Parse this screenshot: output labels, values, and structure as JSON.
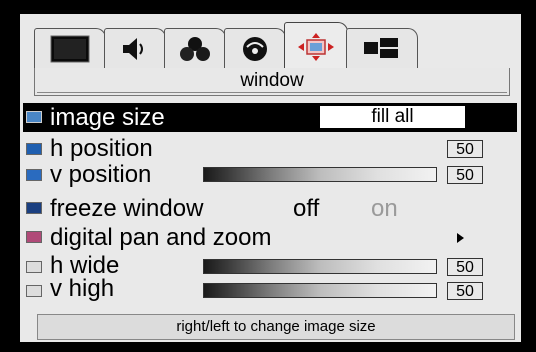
{
  "tabs": [
    {
      "icon": "monitor-icon",
      "active": false
    },
    {
      "icon": "speaker-icon",
      "active": false
    },
    {
      "icon": "color-balls-icon",
      "active": false
    },
    {
      "icon": "lamp-icon",
      "active": false
    },
    {
      "icon": "window-move-icon",
      "active": true
    },
    {
      "icon": "layout-icon",
      "active": false
    }
  ],
  "header": {
    "title": "window"
  },
  "menu": {
    "image_size": {
      "label": "image size",
      "value": "fill all",
      "icon": "image-size-icon"
    },
    "h_position": {
      "label": "h position",
      "value": "50",
      "icon": "h-position-icon"
    },
    "v_position": {
      "label": "v position",
      "value": "50",
      "icon": "v-position-icon"
    },
    "freeze_window": {
      "label": "freeze window",
      "option_off": "off",
      "option_on": "on",
      "icon": "freeze-icon"
    },
    "digital_pan_zoom": {
      "label": "digital pan and zoom",
      "icon": "pan-zoom-icon"
    },
    "h_wide": {
      "label": "h wide",
      "value": "50",
      "icon": "h-wide-icon"
    },
    "v_high": {
      "label": "v high",
      "value": "50",
      "icon": "v-high-icon"
    }
  },
  "help_text": "right/left to change image size",
  "colors": {
    "selected_bg": "#000000",
    "osd_bg": "#e9e9e9",
    "value_box_bg": "#ffffff"
  }
}
